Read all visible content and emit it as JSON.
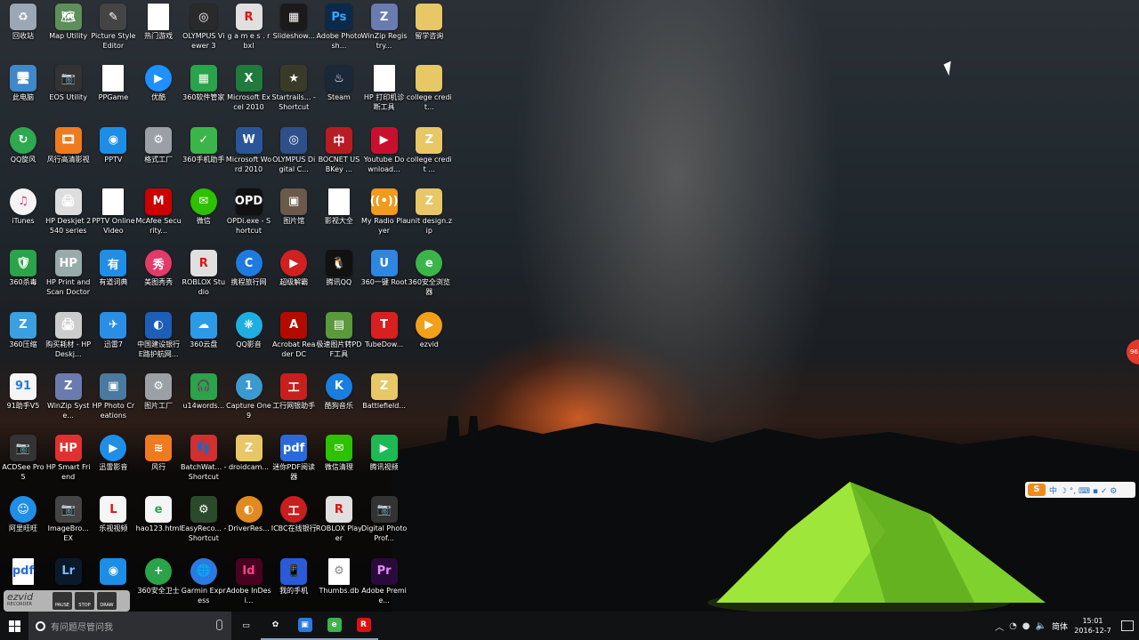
{
  "desktop": {
    "icons": [
      {
        "label": "回收站",
        "bg": "#9aa7b4",
        "g": "♻"
      },
      {
        "label": "Map Utility",
        "bg": "#5e8f5a",
        "g": "🗺"
      },
      {
        "label": "Picture Style Editor",
        "bg": "#444",
        "g": "✎"
      },
      {
        "label": "热门游戏",
        "bg": "doc",
        "g": ""
      },
      {
        "label": "OLYMPUS Viewer 3",
        "bg": "#2a2a2a",
        "g": "◎"
      },
      {
        "label": "g a m e s . rbxl",
        "bg": "#e0e0e0",
        "g": "R",
        "fg": "#d11"
      },
      {
        "label": "Slideshow...",
        "bg": "#1a1a1a",
        "g": "▦"
      },
      {
        "label": "Adobe Photosh...",
        "bg": "#0b2a4a",
        "g": "Ps",
        "fg": "#39a5ff"
      },
      {
        "label": "WinZip Registry...",
        "bg": "#6a7bb0",
        "g": "Z"
      },
      {
        "label": "留学咨询",
        "bg": "#e7c766",
        "g": ""
      },
      {
        "label": "此电脑",
        "bg": "#3f88c9",
        "g": "🖥"
      },
      {
        "label": "EOS Utility",
        "bg": "#333",
        "g": "📷"
      },
      {
        "label": "PPGame",
        "bg": "doc",
        "g": ""
      },
      {
        "label": "优酷",
        "bg": "#1e90ff",
        "g": "▶",
        "round": true
      },
      {
        "label": "360软件管家",
        "bg": "#2aa34a",
        "g": "▦"
      },
      {
        "label": "Microsoft Excel 2010",
        "bg": "#1f7a3c",
        "g": "X"
      },
      {
        "label": "Startrails... - Shortcut",
        "bg": "#3a3a28",
        "g": "★"
      },
      {
        "label": "Steam",
        "bg": "#1b2838",
        "g": "♨"
      },
      {
        "label": "HP 打印机诊断工具",
        "bg": "doc",
        "g": ""
      },
      {
        "label": "college credit...",
        "bg": "#e7c766",
        "g": ""
      },
      {
        "label": "QQ旋风",
        "bg": "#2fa84f",
        "g": "↻",
        "round": true
      },
      {
        "label": "风行高清影视",
        "bg": "#f07a20",
        "g": "🎞"
      },
      {
        "label": "PPTV",
        "bg": "#1c8ee6",
        "g": "◉"
      },
      {
        "label": "格式工厂",
        "bg": "#9aa0a6",
        "g": "⚙"
      },
      {
        "label": "360手机助手",
        "bg": "#3bb54a",
        "g": "✓"
      },
      {
        "label": "Microsoft Word 2010",
        "bg": "#2a5699",
        "g": "W"
      },
      {
        "label": "OLYMPUS Digital C...",
        "bg": "#2f4f8a",
        "g": "◎"
      },
      {
        "label": "BOCNET USBKey ...",
        "bg": "#b81c22",
        "g": "中"
      },
      {
        "label": "Youtube Download...",
        "bg": "#c8102e",
        "g": "▶"
      },
      {
        "label": "college credit ...",
        "bg": "#e7c766",
        "g": "Z"
      },
      {
        "label": "iTunes",
        "bg": "#f4f4f4",
        "g": "♫",
        "fg": "#e0377a",
        "round": true
      },
      {
        "label": "HP Deskjet 2540 series",
        "bg": "#ddd",
        "g": "🖨"
      },
      {
        "label": "PPTV Online Video",
        "bg": "doc",
        "g": ""
      },
      {
        "label": "McAfee Security...",
        "bg": "#c00",
        "g": "M"
      },
      {
        "label": "微信",
        "bg": "#2dc100",
        "g": "✉",
        "round": true
      },
      {
        "label": "OPDi.exe - Shortcut",
        "bg": "#111",
        "g": "OPD"
      },
      {
        "label": "图片馆",
        "bg": "#6b5a4a",
        "g": "▣"
      },
      {
        "label": "影视大全",
        "bg": "doc",
        "g": ""
      },
      {
        "label": "My Radio Player",
        "bg": "#f29a1a",
        "g": "((•))"
      },
      {
        "label": "unit design.zip",
        "bg": "#e7c766",
        "g": "Z"
      },
      {
        "label": "360杀毒",
        "bg": "#2aa34a",
        "g": "🛡"
      },
      {
        "label": "HP Print and Scan Doctor",
        "bg": "#9aa",
        "g": "HP"
      },
      {
        "label": "有道词典",
        "bg": "#1f8ee6",
        "g": "有"
      },
      {
        "label": "美图秀秀",
        "bg": "#e23b6a",
        "g": "秀",
        "round": true
      },
      {
        "label": "ROBLOX Studio",
        "bg": "#e0e0e0",
        "g": "R",
        "fg": "#d11"
      },
      {
        "label": "携程旅行网",
        "bg": "#1f7ae0",
        "g": "C",
        "round": true
      },
      {
        "label": "超级解霸",
        "bg": "#d02020",
        "g": "▶",
        "round": true
      },
      {
        "label": "腾讯QQ",
        "bg": "#111",
        "g": "🐧"
      },
      {
        "label": "360一键 Root",
        "bg": "#2e86de",
        "g": "U"
      },
      {
        "label": "360安全浏览器",
        "bg": "#3bb54a",
        "g": "e",
        "round": true
      },
      {
        "label": "360压缩",
        "bg": "#3aa0e0",
        "g": "Z"
      },
      {
        "label": "购买耗材 - HP Deskj...",
        "bg": "#ccc",
        "g": "🖨"
      },
      {
        "label": "迅雷7",
        "bg": "#2b8ee6",
        "g": "✈"
      },
      {
        "label": "中国建设银行E路护航网...",
        "bg": "#1d5fb8",
        "g": "◐"
      },
      {
        "label": "360云盘",
        "bg": "#2d9ae8",
        "g": "☁"
      },
      {
        "label": "QQ影音",
        "bg": "#1eaee0",
        "g": "❋",
        "round": true
      },
      {
        "label": "Acrobat Reader DC",
        "bg": "#b30b00",
        "g": "A"
      },
      {
        "label": "极速图片转PDF工具",
        "bg": "#5a9a3a",
        "g": "▤"
      },
      {
        "label": "TubeDow...",
        "bg": "#d82020",
        "g": "T"
      },
      {
        "label": "ezvid",
        "bg": "#f2a01a",
        "g": "▶",
        "round": true
      },
      {
        "label": "91助手V5",
        "bg": "#f5f5f5",
        "g": "91",
        "fg": "#2a7ae0"
      },
      {
        "label": "WinZip Syste...",
        "bg": "#6a7bb0",
        "g": "Z"
      },
      {
        "label": "HP Photo Creations",
        "bg": "#4a7aa0",
        "g": "▣"
      },
      {
        "label": "图片工厂",
        "bg": "#9aa0a6",
        "g": "⚙"
      },
      {
        "label": "u14words...",
        "bg": "#2aa34a",
        "g": "🎧"
      },
      {
        "label": "Capture One 9",
        "bg": "#3a9ad0",
        "g": "1",
        "round": true
      },
      {
        "label": "工行网银助手",
        "bg": "#c81e1e",
        "g": "工"
      },
      {
        "label": "酷狗音乐",
        "bg": "#1a7de0",
        "g": "K",
        "round": true
      },
      {
        "label": "Battlefield...",
        "bg": "#e7c766",
        "g": "Z"
      },
      {
        "label": "",
        "bg": "none",
        "g": ""
      },
      {
        "label": "ACDSee Pro 5",
        "bg": "#333",
        "g": "📷"
      },
      {
        "label": "HP Smart Friend",
        "bg": "#e03030",
        "g": "HP"
      },
      {
        "label": "迅雷影音",
        "bg": "#1f8ee6",
        "g": "▶",
        "round": true
      },
      {
        "label": "风行",
        "bg": "#f07a20",
        "g": "≋"
      },
      {
        "label": "BatchWat... - Shortcut",
        "bg": "#d03030",
        "g": "👣"
      },
      {
        "label": "droidcam...",
        "bg": "#e7c766",
        "g": "Z"
      },
      {
        "label": "迷你PDF阅读器",
        "bg": "#2a6ad8",
        "g": "pdf"
      },
      {
        "label": "微信清理",
        "bg": "#2dc100",
        "g": "✉"
      },
      {
        "label": "腾讯视频",
        "bg": "#1db954",
        "g": "▶"
      },
      {
        "label": "",
        "bg": "none",
        "g": ""
      },
      {
        "label": "阿里旺旺",
        "bg": "#1f8ee6",
        "g": "☺",
        "round": true
      },
      {
        "label": "ImageBro... EX",
        "bg": "#444",
        "g": "📷"
      },
      {
        "label": "乐视视频",
        "bg": "#f5f5f5",
        "g": "L",
        "fg": "#d11"
      },
      {
        "label": "hao123.html",
        "bg": "#f5f5f5",
        "g": "e",
        "fg": "#2aa34a"
      },
      {
        "label": "EasyReco... - Shortcut",
        "bg": "#2b4a2b",
        "g": "⚙"
      },
      {
        "label": "DriverRes...",
        "bg": "#e08a20",
        "g": "◐",
        "round": true
      },
      {
        "label": "ICBC在线银行",
        "bg": "#c81e1e",
        "g": "工",
        "round": true
      },
      {
        "label": "ROBLOX Player",
        "bg": "#e0e0e0",
        "g": "R",
        "fg": "#d11"
      },
      {
        "label": "Digital Photo Prof...",
        "bg": "#333",
        "g": "📷"
      },
      {
        "label": "",
        "bg": "none",
        "g": ""
      },
      {
        "label": "",
        "bg": "doc",
        "g": "pdf",
        "fg": "#2a6ad8"
      },
      {
        "label": "",
        "bg": "#0a1a2a",
        "g": "Lr",
        "fg": "#79b8ff"
      },
      {
        "label": "",
        "bg": "#1c8ee6",
        "g": "◉"
      },
      {
        "label": "360安全卫士",
        "bg": "#2aa34a",
        "g": "+",
        "round": true
      },
      {
        "label": "Garmin Express",
        "bg": "#2a7ae0",
        "g": "🌐",
        "round": true
      },
      {
        "label": "Adobe InDesi...",
        "bg": "#49021f",
        "g": "Id",
        "fg": "#ff3f94"
      },
      {
        "label": "我的手机",
        "bg": "#2a5ad8",
        "g": "📱"
      },
      {
        "label": "Thumbs.db",
        "bg": "doc",
        "g": "⚙"
      },
      {
        "label": "Adobe Premie...",
        "bg": "#2a0a3a",
        "g": "Pr",
        "fg": "#e28bff"
      },
      {
        "label": "",
        "bg": "none",
        "g": ""
      }
    ]
  },
  "side_badge": "96",
  "ime_bar": {
    "logo": "S",
    "items": "中 ☽ °, ⌨ ▪ ✓ ⚙"
  },
  "ezvid": {
    "brand": "ezvid",
    "sub": "RECORDER",
    "pause": "PAUSE",
    "stop": "STOP",
    "draw": "DRAW"
  },
  "taskbar": {
    "search_placeholder": "有问题尽管问我",
    "apps": [
      {
        "name": "task-view-button",
        "g": "▭",
        "bg": "none"
      },
      {
        "name": "taskbar-app-1",
        "g": "✿",
        "bg": "none"
      },
      {
        "name": "taskbar-app-2",
        "g": "▣",
        "bg": "#2a7ae0"
      },
      {
        "name": "taskbar-app-3",
        "g": "e",
        "bg": "#3bb54a"
      },
      {
        "name": "taskbar-app-4",
        "g": "R",
        "bg": "#d11"
      }
    ],
    "tray": {
      "ime_label": "简体",
      "time": "15:01",
      "date": "2016-12-7"
    }
  }
}
